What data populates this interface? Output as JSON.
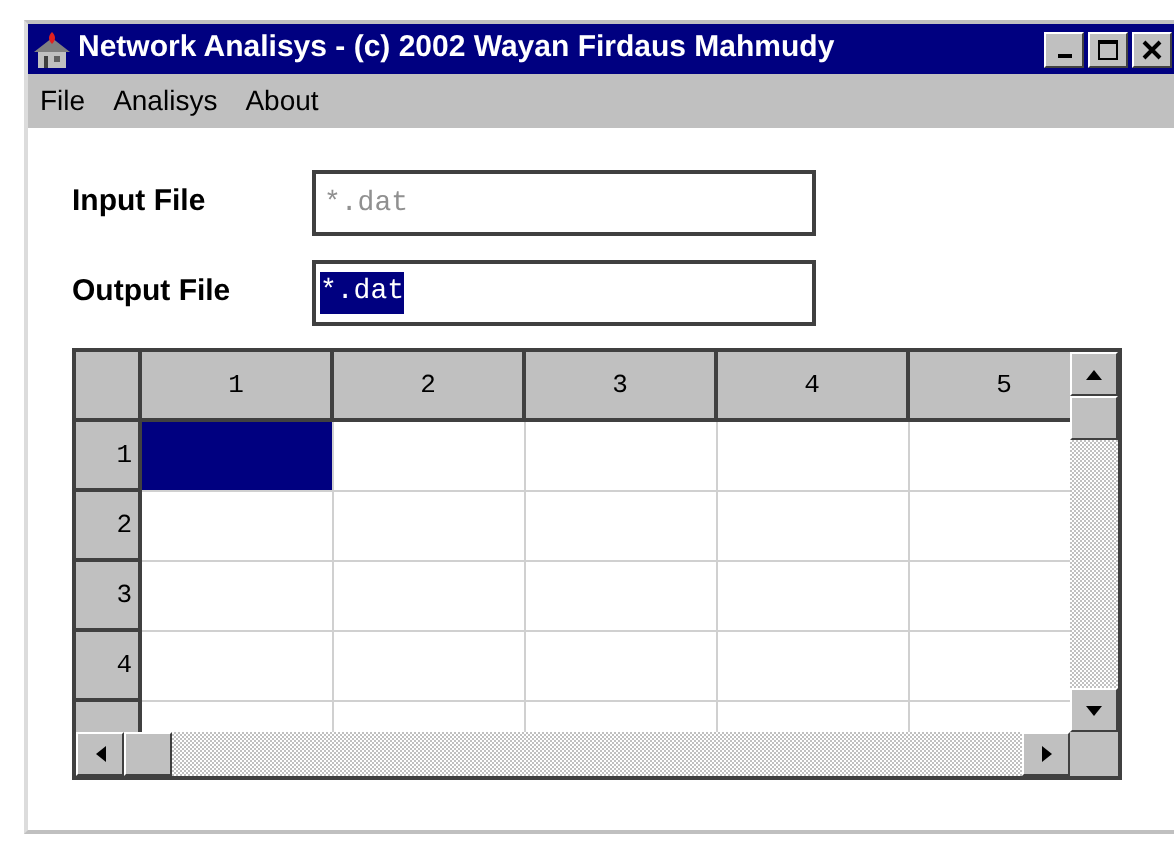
{
  "window": {
    "title": "Network Analisys - (c) 2002  Wayan Firdaus Mahmudy"
  },
  "menu": [
    "File",
    "Analisys",
    "About"
  ],
  "input_file": {
    "label": "Input File",
    "placeholder": "*.dat"
  },
  "output_file": {
    "label": "Output File",
    "value": "*.dat",
    "selected": true
  },
  "grid": {
    "columns": [
      "1",
      "2",
      "3",
      "4",
      "5"
    ],
    "rows": [
      {
        "label": "1",
        "cells": [
          {
            "selected": true
          },
          {
            "selected": false
          },
          {
            "selected": false
          },
          {
            "selected": false
          },
          {
            "selected": false
          }
        ]
      },
      {
        "label": "2",
        "cells": [
          {
            "selected": false
          },
          {
            "selected": false
          },
          {
            "selected": false
          },
          {
            "selected": false
          },
          {
            "selected": false
          }
        ]
      },
      {
        "label": "3",
        "cells": [
          {
            "selected": false
          },
          {
            "selected": false
          },
          {
            "selected": false
          },
          {
            "selected": false
          },
          {
            "selected": false
          }
        ]
      },
      {
        "label": "4",
        "cells": [
          {
            "selected": false
          },
          {
            "selected": false
          },
          {
            "selected": false
          },
          {
            "selected": false
          },
          {
            "selected": false
          }
        ]
      }
    ]
  }
}
